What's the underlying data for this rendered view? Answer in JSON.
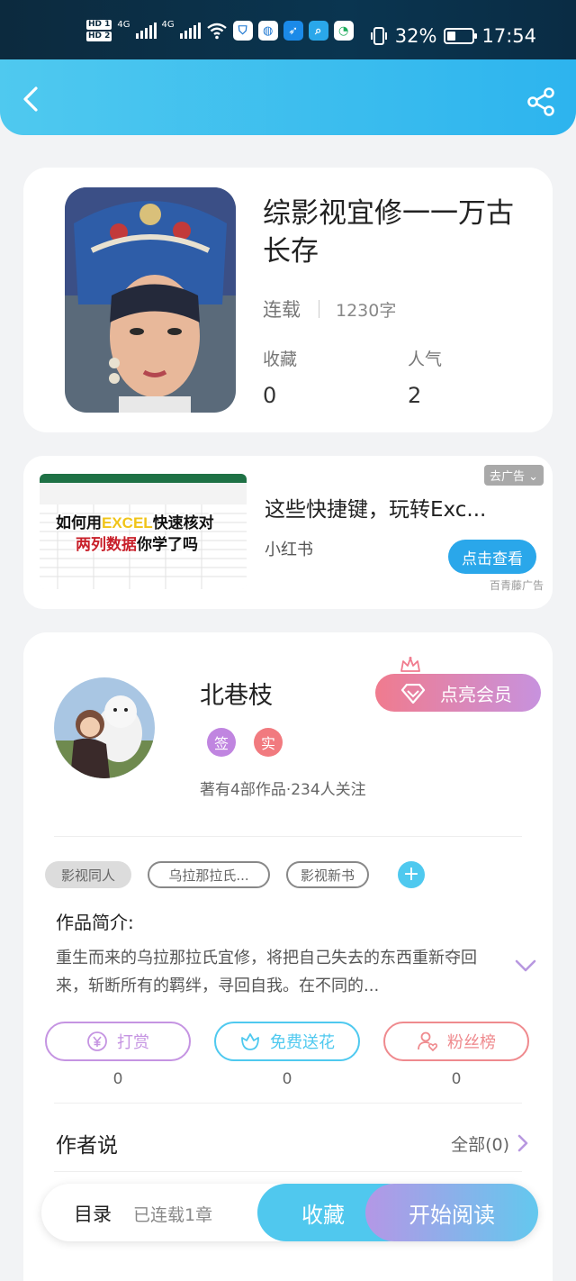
{
  "status_bar": {
    "hd1": "HD 1",
    "hd2": "HD 2",
    "net1": "4G",
    "net2": "4G",
    "battery_level": 32,
    "battery": "32%",
    "time": "17:54"
  },
  "book": {
    "title": "综影视宜修一一万古长存",
    "status": "连载",
    "words": "1230字",
    "stats": [
      {
        "label": "收藏",
        "value": "0"
      },
      {
        "label": "人气",
        "value": "2"
      }
    ]
  },
  "ad": {
    "close": "去广告",
    "image_line1a": "如何用",
    "image_line1b": "EXCEL",
    "image_line1c": "快速核对",
    "image_line2a": "两列数据",
    "image_line2b": "你学了吗",
    "title": "这些快捷键，玩转Exc...",
    "source": "小红书",
    "button": "点击查看",
    "tag": "百青藤广告"
  },
  "author": {
    "name": "北巷枝",
    "badges": [
      {
        "text": "签",
        "color": "#c085e0"
      },
      {
        "text": "实",
        "color": "#f17a7f"
      }
    ],
    "meta": "著有4部作品·234人关注",
    "vip_label": "点亮会员"
  },
  "tags": [
    "影视同人",
    "乌拉那拉氏...",
    "影视新书"
  ],
  "intro": {
    "heading": "作品简介:",
    "text": "重生而来的乌拉那拉氏宜修，将把自己失去的东西重新夺回来，斩断所有的羁绊，寻回自我。在不同的..."
  },
  "actions": [
    {
      "label": "打赏",
      "count": "0",
      "color": "#c594e2"
    },
    {
      "label": "免费送花",
      "count": "0",
      "color": "#4fc9ef"
    },
    {
      "label": "粉丝榜",
      "count": "0",
      "color": "#ef8a8e"
    }
  ],
  "author_says": {
    "heading": "作者说",
    "all": "全部(0)"
  },
  "bottom": {
    "toc": "目录",
    "chapters": "已连载1章",
    "collect": "收藏",
    "read": "开始阅读"
  }
}
